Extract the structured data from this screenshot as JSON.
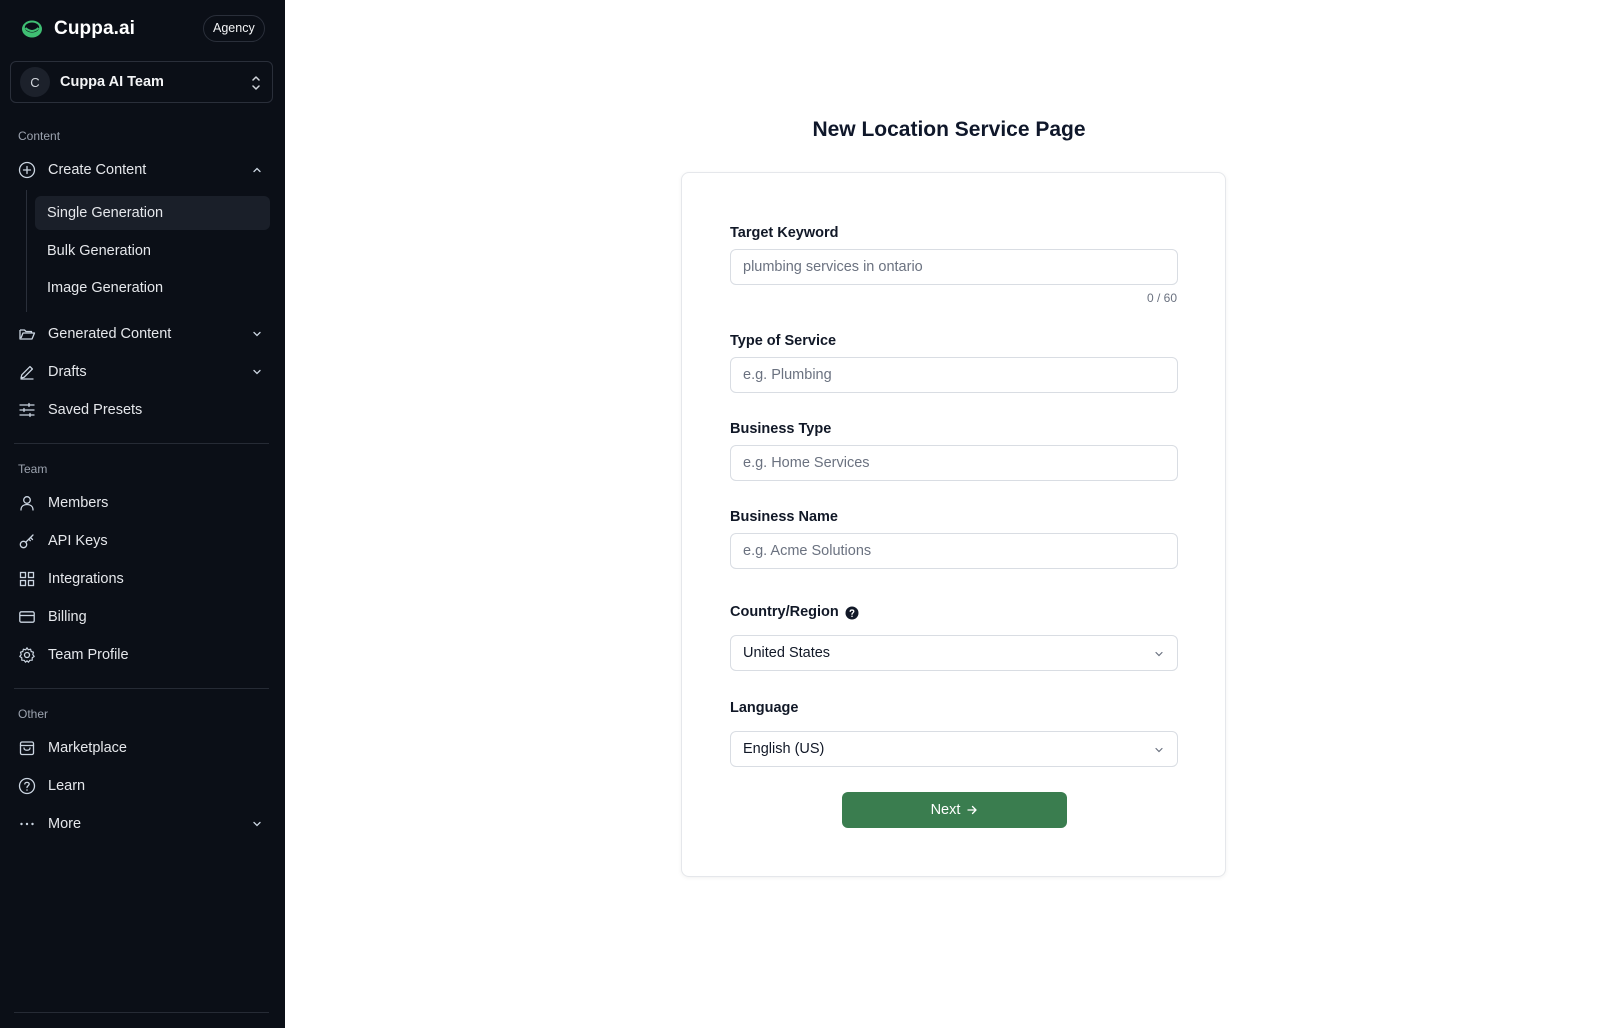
{
  "app": {
    "brand_name": "Cuppa.ai",
    "plan_badge": "Agency",
    "accent_color": "#3a7d4f",
    "sidebar_bg": "#0b0f17"
  },
  "team_switcher": {
    "avatar_initial": "C",
    "team_name": "Cuppa AI Team"
  },
  "sidebar": {
    "content_section": {
      "label": "Content",
      "create_content": "Create Content",
      "sub_items": [
        "Single Generation",
        "Bulk Generation",
        "Image Generation"
      ],
      "active_sub_item": "Single Generation",
      "generated_content": "Generated Content",
      "drafts": "Drafts",
      "saved_presets": "Saved Presets"
    },
    "team_section": {
      "label": "Team",
      "items": [
        "Members",
        "API Keys",
        "Integrations",
        "Billing",
        "Team Profile"
      ]
    },
    "other_section": {
      "label": "Other",
      "items": [
        "Marketplace",
        "Learn",
        "More"
      ]
    }
  },
  "main": {
    "title": "New Location Service Page",
    "form": {
      "target_keyword": {
        "label": "Target Keyword",
        "value": "",
        "placeholder": "plumbing services in ontario",
        "counter": "0 / 60"
      },
      "type_of_service": {
        "label": "Type of Service",
        "value": "",
        "placeholder": "e.g. Plumbing"
      },
      "business_type": {
        "label": "Business Type",
        "value": "",
        "placeholder": "e.g. Home Services"
      },
      "business_name": {
        "label": "Business Name",
        "value": "",
        "placeholder": "e.g. Acme Solutions"
      },
      "country_region": {
        "label": "Country/Region",
        "selected": "United States",
        "help_icon": "question-circle-icon"
      },
      "language": {
        "label": "Language",
        "selected": "English (US)"
      },
      "next_button": "Next"
    }
  }
}
